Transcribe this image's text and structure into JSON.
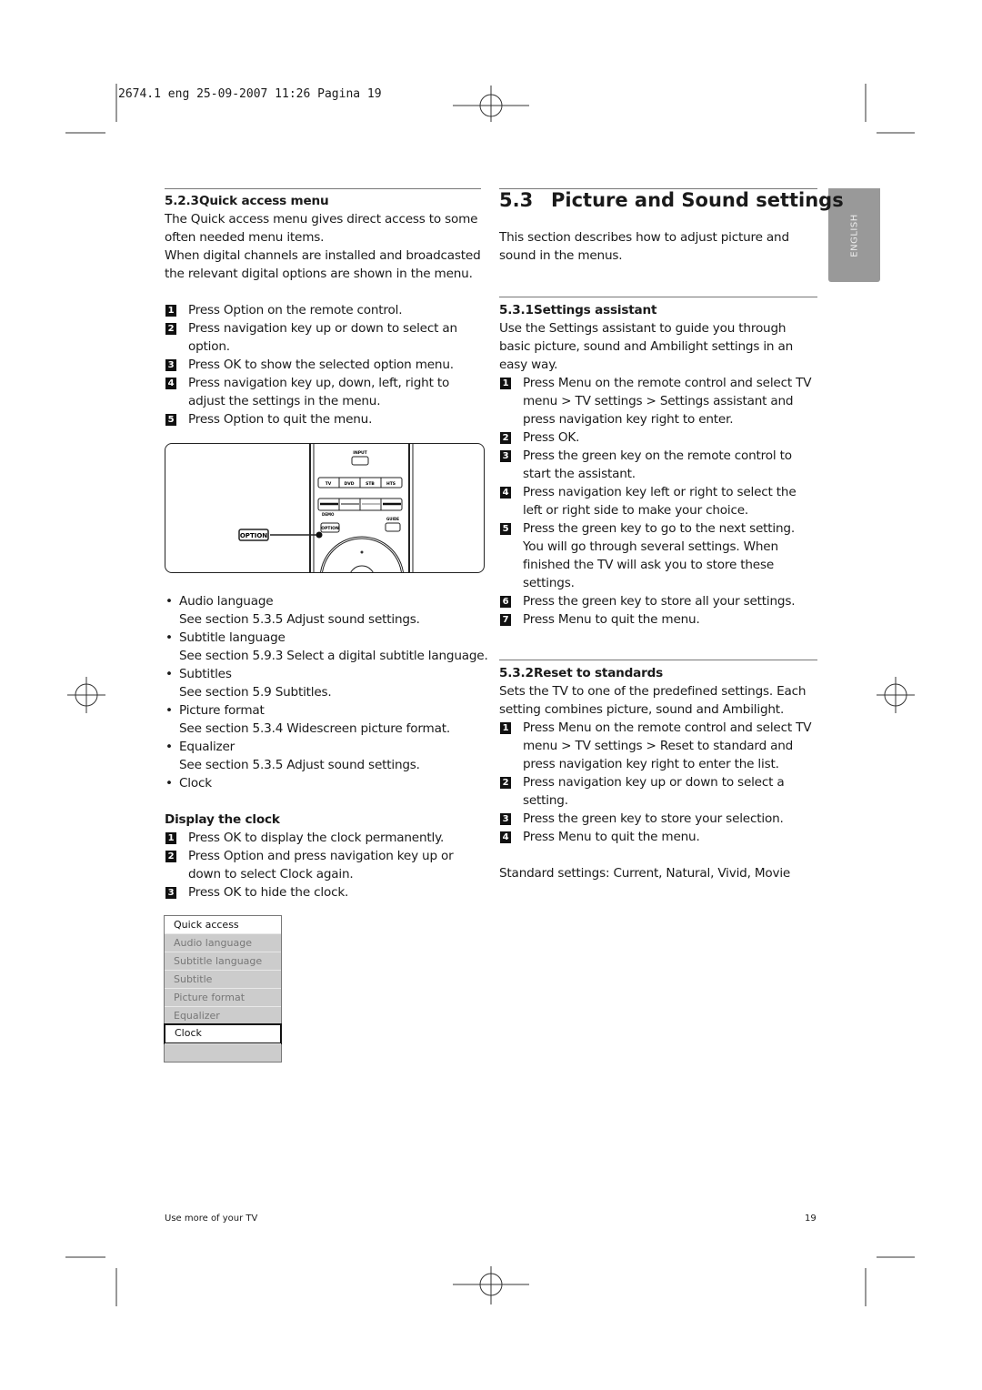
{
  "print_header": "2674.1 eng  25-09-2007  11:26  Pagina 19",
  "side_tab": "ENGLISH",
  "left": {
    "quick_access": {
      "number": "5.2.3",
      "title": "Quick access menu",
      "intro": [
        "The Quick access menu gives direct access to some often needed menu items.",
        "When digital channels are installed and broadcasted the relevant digital options are shown in the menu."
      ],
      "steps": [
        "Press Option on the remote control.",
        "Press navigation key up or down to select an option.",
        "Press OK to show the selected option menu.",
        "Press navigation key up, down, left, right to adjust the settings in the menu.",
        "Press Option to quit the menu."
      ]
    },
    "remote": {
      "input": "INPUT",
      "sources": [
        "TV",
        "DVD",
        "STB",
        "HTS"
      ],
      "demo": "DEMO",
      "guide": "GUIDE",
      "option": "OPTION",
      "callout": "OPTION"
    },
    "options": [
      {
        "item": "Audio language",
        "ref": "See section 5.3.5 Adjust sound settings."
      },
      {
        "item": "Subtitle language",
        "ref": "See section 5.9.3 Select a digital subtitle language."
      },
      {
        "item": "Subtitles",
        "ref": "See section 5.9 Subtitles."
      },
      {
        "item": "Picture format",
        "ref": "See section 5.3.4 Widescreen picture format."
      },
      {
        "item": "Equalizer",
        "ref": "See section 5.3.5 Adjust sound settings."
      },
      {
        "item": "Clock",
        "ref": ""
      }
    ],
    "display_clock": {
      "title": "Display the clock",
      "steps": [
        "Press OK to display the clock permanently.",
        "Press Option and press navigation key up or down to select Clock again.",
        "Press OK to hide the clock."
      ]
    },
    "menu": {
      "title": "Quick access",
      "items": [
        "Audio language",
        "Subtitle language",
        "Subtitle",
        "Picture format",
        "Equalizer",
        "Clock"
      ],
      "selected": "Clock"
    }
  },
  "right": {
    "section": {
      "number": "5.3",
      "title": "Picture and Sound settings",
      "intro": "This section describes how to adjust picture and sound in the menus."
    },
    "assistant": {
      "number": "5.3.1",
      "title": "Settings assistant",
      "intro": "Use the Settings assistant to guide you through basic picture, sound and Ambilight settings in an easy way.",
      "steps": [
        "Press Menu on the remote control and select TV menu > TV settings > Settings assistant and press navigation key right to enter.",
        "Press OK.",
        "Press the green key on the remote control to start the assistant.",
        "Press navigation key left or right to select the left or right side to make your choice.",
        "Press the green key to go to the next setting. You will go through several settings. When finished the TV will ask you to store these settings.",
        "Press the green key to store all your settings.",
        "Press Menu to quit the menu."
      ]
    },
    "reset": {
      "number": "5.3.2",
      "title": "Reset to standards",
      "intro": "Sets the TV to one of the predefined settings. Each setting combines picture, sound and Ambilight.",
      "steps": [
        "Press Menu on the remote control and select TV menu > TV settings > Reset to standard and press navigation key right to enter the list.",
        "Press navigation key up or down to select a setting.",
        "Press the green key to store your selection.",
        "Press Menu to quit the menu."
      ],
      "standard": "Standard settings: Current, Natural, Vivid, Movie"
    }
  },
  "footer": {
    "left": "Use more of your TV",
    "page": "19"
  }
}
